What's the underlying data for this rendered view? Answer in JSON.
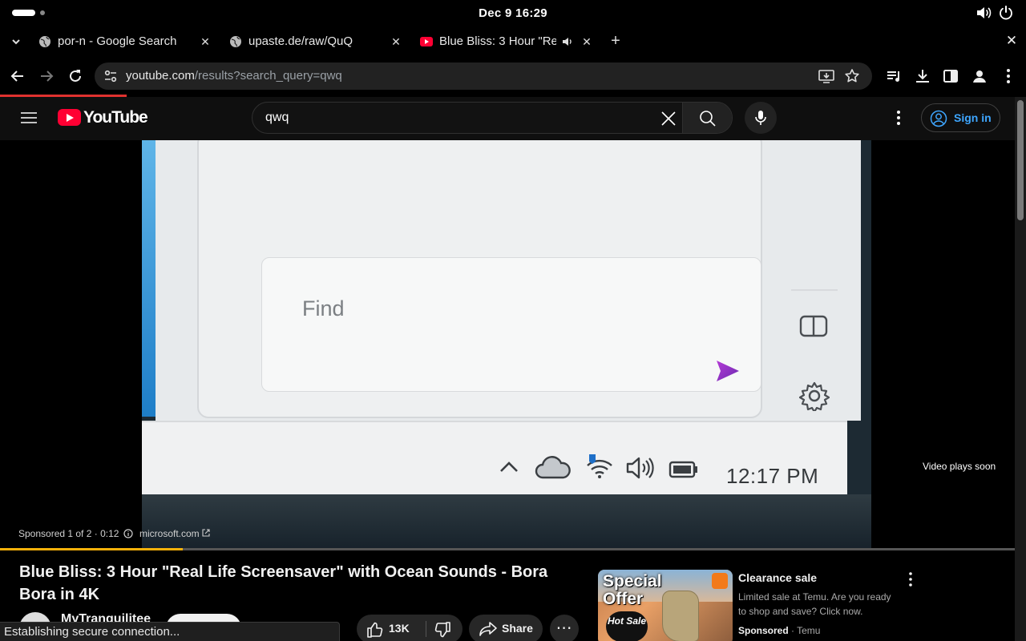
{
  "system": {
    "clock": "Dec 9  16:29"
  },
  "tabs": [
    {
      "title": "por-n - Google Search",
      "close": "✕"
    },
    {
      "title": "upaste.de/raw/QuQ",
      "close": "✕"
    },
    {
      "title": "Blue Bliss: 3 Hour \"Real",
      "close": "✕"
    }
  ],
  "tabbar": {
    "new_tab": "+",
    "window_close": "✕"
  },
  "omnibox": {
    "domain": "youtube.com",
    "path": "/results?search_query=qwq"
  },
  "youtube": {
    "logo_text": "YouTube",
    "search_value": "qwq",
    "signin_label": "Sign in"
  },
  "player": {
    "embedded_find_text": "Find",
    "embedded_clock": "12:17 PM",
    "plays_soon": "Video plays soon",
    "ad_info": "Sponsored 1 of 2 · 0:12",
    "ad_domain": "microsoft.com",
    "progress_percent": 18
  },
  "video": {
    "title": "Blue Bliss: 3 Hour \"Real Life Screensaver\" with Ocean Sounds - Bora Bora in 4K",
    "channel": "MyTranquilitee",
    "likes": "13K",
    "share_label": "Share",
    "more_label": "⋯"
  },
  "status_bubble": "Establishing secure connection...",
  "ad_card": {
    "thumb_headline": "Special Offer",
    "thumb_badge": "Hot Sale",
    "title": "Clearance sale",
    "description": "Limited sale at Temu. Are you ready to shop and save? Click now.",
    "sponsored": "Sponsored",
    "advertiser": "Temu"
  },
  "colors": {
    "yt_red": "#ff0033",
    "link_blue": "#3ea6ff",
    "progress_yellow": "#f6b10a",
    "load_red": "#e0322f"
  }
}
